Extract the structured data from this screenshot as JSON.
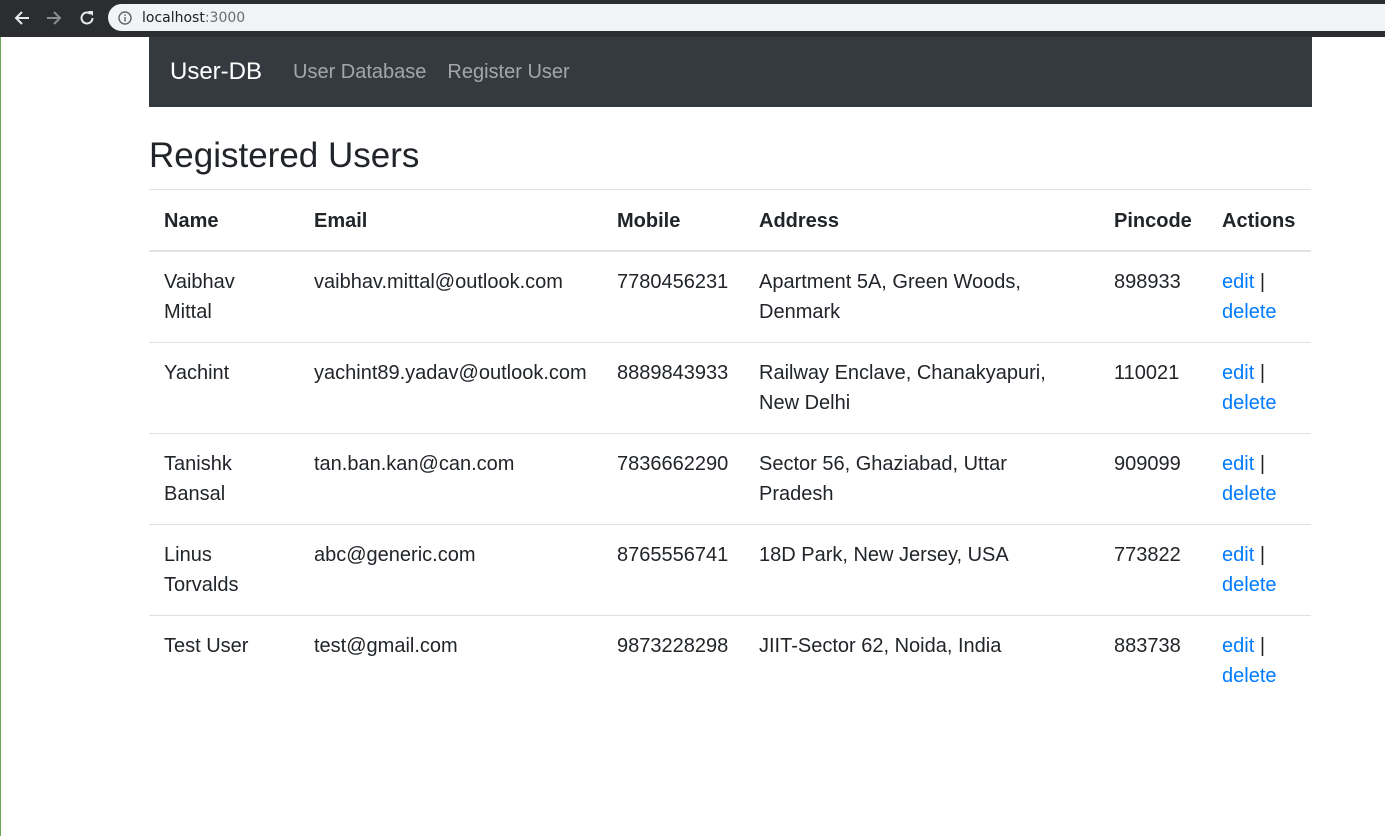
{
  "browser": {
    "url_host": "localhost",
    "url_port": ":3000"
  },
  "navbar": {
    "brand": "User-DB",
    "links": [
      "User Database",
      "Register User"
    ]
  },
  "page": {
    "title": "Registered Users"
  },
  "table": {
    "headers": [
      "Name",
      "Email",
      "Mobile",
      "Address",
      "Pincode",
      "Actions"
    ],
    "edit_label": "edit",
    "separator": "|",
    "delete_label": "delete",
    "rows": [
      {
        "name": "Vaibhav Mittal",
        "email": "vaibhav.mittal@outlook.com",
        "mobile": "7780456231",
        "address": "Apartment 5A, Green Woods, Denmark",
        "pincode": "898933"
      },
      {
        "name": "Yachint",
        "email": "yachint89.yadav@outlook.com",
        "mobile": "8889843933",
        "address": "Railway Enclave, Chanakyapuri, New Delhi",
        "pincode": "110021"
      },
      {
        "name": "Tanishk Bansal",
        "email": "tan.ban.kan@can.com",
        "mobile": "7836662290",
        "address": "Sector 56, Ghaziabad, Uttar Pradesh",
        "pincode": "909099"
      },
      {
        "name": "Linus Torvalds",
        "email": "abc@generic.com",
        "mobile": "8765556741",
        "address": "18D Park, New Jersey, USA",
        "pincode": "773822"
      },
      {
        "name": "Test User",
        "email": "test@gmail.com",
        "mobile": "9873228298",
        "address": "JIIT-Sector 62, Noida, India",
        "pincode": "883738"
      }
    ]
  },
  "colors": {
    "navbar_bg": "#343a40",
    "link": "#007bff"
  }
}
